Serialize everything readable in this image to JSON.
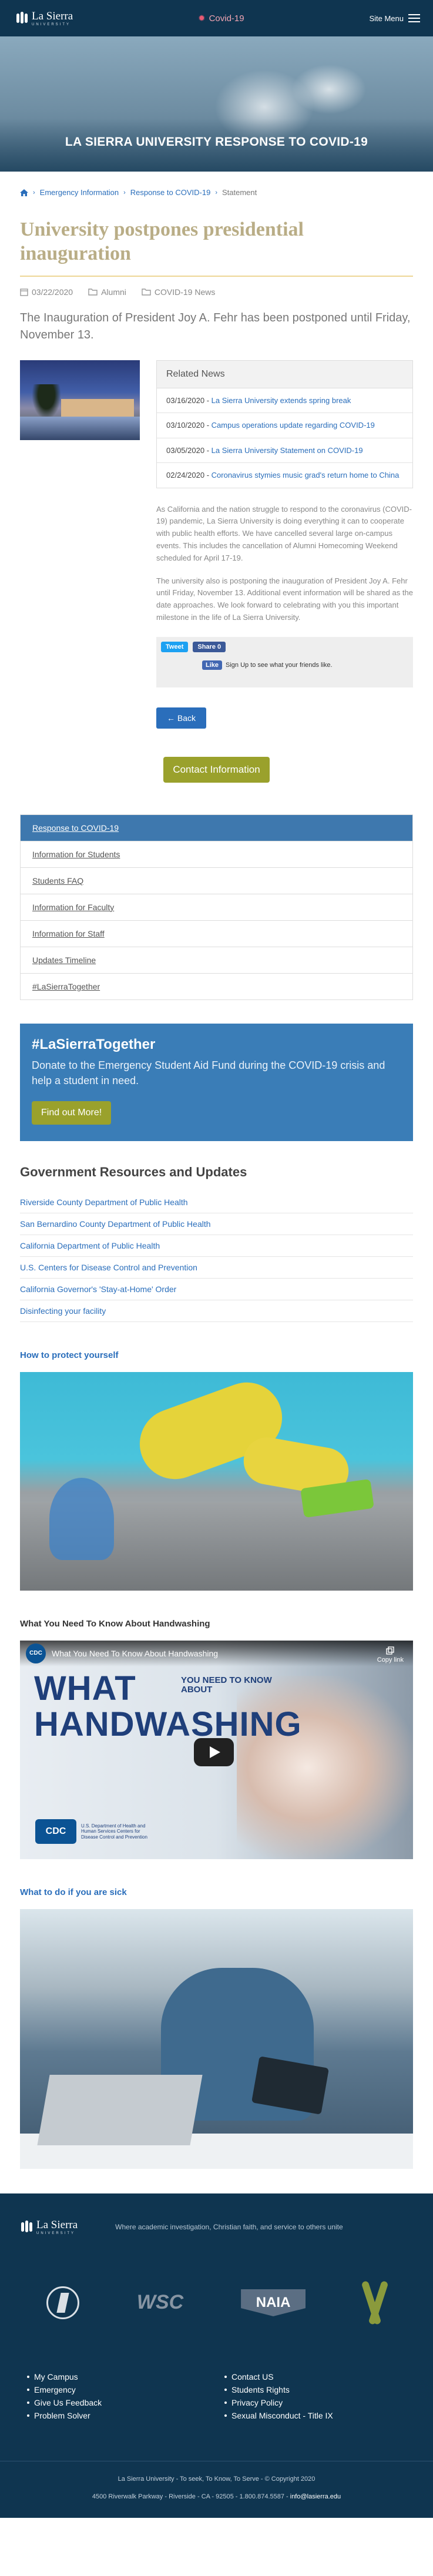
{
  "header": {
    "logo_name": "La Sierra",
    "logo_sub": "UNIVERSITY",
    "covid_link": "Covid-19",
    "menu_label": "Site Menu"
  },
  "hero": {
    "title": "LA SIERRA UNIVERSITY RESPONSE TO COVID-19"
  },
  "breadcrumb": {
    "items": [
      "Emergency Information",
      "Response to COVID-19",
      "Statement"
    ]
  },
  "article": {
    "title": "University postpones presidential inauguration",
    "date": "03/22/2020",
    "category1": "Alumni",
    "category2": "COVID-19 News",
    "lead": "The Inauguration of President Joy A. Fehr has been postponed until Friday, November 13.",
    "p1": "As California and the nation struggle to respond to the coronavirus (COVID-19) pandemic, La Sierra University is doing everything it can to cooperate with public health efforts. We have cancelled several large on-campus events. This includes the cancellation of Alumni Homecoming Weekend scheduled for April 17-19.",
    "p2": "The university also is postponing the inauguration of President Joy A. Fehr until Friday, November 13. Additional event information will be shared as the date approaches. We look forward to celebrating with you this important milestone in the life of La Sierra University."
  },
  "related": {
    "heading": "Related News",
    "items": [
      {
        "date": "03/16/2020",
        "title": "La Sierra University extends spring break"
      },
      {
        "date": "03/10/2020",
        "title": "Campus operations update regarding COVID-19"
      },
      {
        "date": "03/05/2020",
        "title": "La Sierra University Statement on COVID-19"
      },
      {
        "date": "02/24/2020",
        "title": "Coronavirus stymies music grad's return home to China"
      }
    ]
  },
  "share": {
    "tweet": "Tweet",
    "fb_share": "Share 0",
    "fb_like": "Like",
    "like_text": "Sign Up to see what your friends like."
  },
  "buttons": {
    "back": "← Back",
    "contact": "Contact Information"
  },
  "subnav": {
    "items": [
      "Response to COVID-19",
      "Information for Students",
      "Students FAQ",
      "Information for Faculty",
      "Information for Staff",
      "Updates Timeline",
      "#LaSierraTogether"
    ]
  },
  "promo": {
    "tag": "#LaSierraTogether",
    "text": "Donate to the Emergency Student Aid Fund during the COVID-19 crisis and help a student in need.",
    "button": "Find out More!"
  },
  "resources": {
    "heading": "Government Resources and Updates",
    "items": [
      "Riverside County Department of Public Health",
      "San Bernardino County Department of Public Health",
      "California Department of Public Health",
      "U.S. Centers for Disease Control and Prevention",
      "California Governor's 'Stay-at-Home' Order",
      "Disinfecting your facility"
    ]
  },
  "sections": {
    "protect": "How to protect yourself",
    "handwashing": "What You Need To Know About Handwashing",
    "sick": "What to do if you are sick"
  },
  "video": {
    "title": "What You Need To Know About Handwashing",
    "badge": "CDC",
    "copy_link": "Copy link",
    "big_what": "WHAT",
    "need_to_know": "YOU NEED TO KNOW ABOUT",
    "big_hand": "HANDWASHING",
    "cdc_logo": "CDC",
    "cdc_text": "U.S. Department of Health and Human Services Centers for Disease Control and Prevention"
  },
  "footer": {
    "logo_name": "La Sierra",
    "logo_sub": "UNIVERSITY",
    "mission": "Where academic investigation, Christian faith, and service to others unite",
    "wasc": "WSC",
    "naia": "NAIA",
    "col1": [
      "My Campus",
      "Emergency",
      "Give Us Feedback",
      "Problem Solver"
    ],
    "col2": [
      "Contact US",
      "Students Rights",
      "Privacy Policy",
      "Sexual Misconduct - Title IX"
    ],
    "tagline": "La Sierra University - To seek, To Know, To Serve - © Copyright 2020",
    "address": "4500 Riverwalk Parkway - Riverside - CA - 92505 - 1.800.874.5587 - ",
    "email": "info@lasierra.edu"
  },
  "colors": {
    "navy": "#0f3550",
    "link_blue": "#2a6ebb",
    "gold_title": "#b9ad86",
    "olive_button": "#9aa12c",
    "promo_blue": "#3a7db7"
  }
}
